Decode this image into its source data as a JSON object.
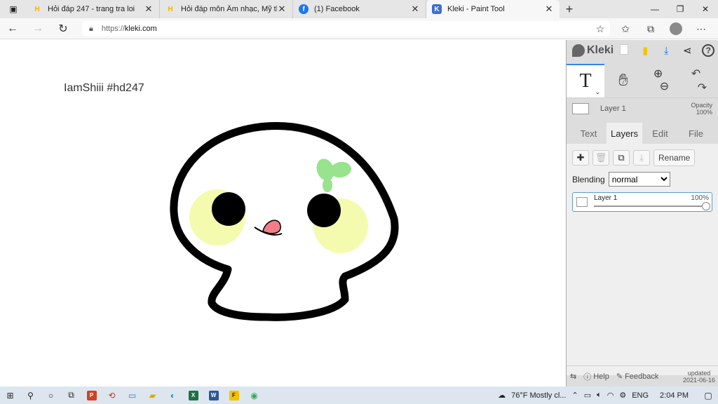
{
  "browser": {
    "tabs": [
      {
        "title": "Hỏi đáp 247 - trang tra loi",
        "favicon": "hoidap-icon",
        "active": false
      },
      {
        "title": "Hỏi đáp môn Âm nhạc, Mỹ thuật",
        "favicon": "hoidap-icon",
        "active": false
      },
      {
        "title": "(1) Facebook",
        "favicon": "facebook-icon",
        "active": false
      },
      {
        "title": "Kleki - Paint Tool",
        "favicon": "kleki-icon",
        "active": true
      }
    ],
    "url_prefix": "https://",
    "url_host": "kleki.com"
  },
  "canvas": {
    "text": "IamShiii #hd247",
    "colors": {
      "outline": "#000000",
      "cheek": "#f5fbae",
      "sprout": "#98e38d",
      "tongue": "#f27d86"
    }
  },
  "kleki": {
    "logo": "Kleki",
    "layer_mini": {
      "name": "Layer 1",
      "opacity_label": "Opacity",
      "opacity_value": "100%"
    },
    "tabs": [
      "Text",
      "Layers",
      "Edit",
      "File"
    ],
    "rename_label": "Rename",
    "blending_label": "Blending",
    "blending_value": "normal",
    "layers": [
      {
        "name": "Layer 1",
        "opacity": "100%"
      }
    ],
    "help_label": "Help",
    "feedback_label": "Feedback",
    "updated_label": "updated",
    "updated_date": "2021-06-16"
  },
  "taskbar": {
    "weather": "76°F  Mostly cl...",
    "language": "ENG",
    "time": "2:04 PM",
    "apps": [
      "P",
      "F",
      "W",
      "X"
    ]
  }
}
